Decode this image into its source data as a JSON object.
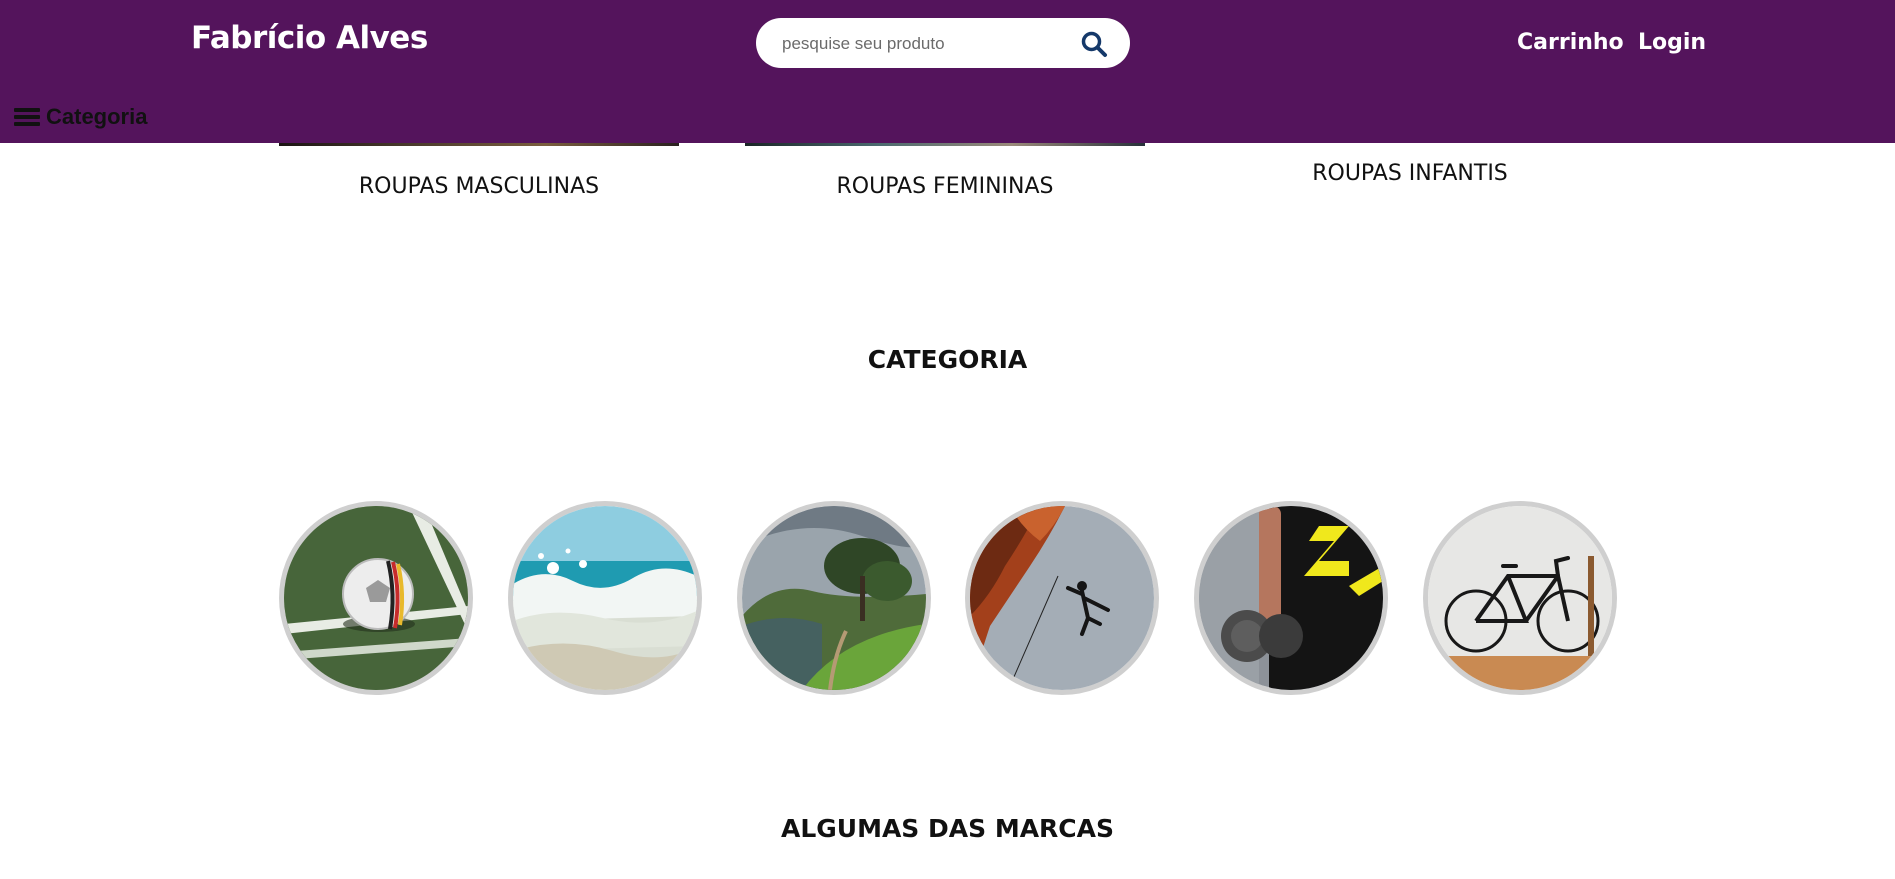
{
  "header": {
    "brand": "Fabrício Alves",
    "search": {
      "placeholder": "pesquise seu produto",
      "value": ""
    },
    "nav": {
      "cart": "Carrinho",
      "login": "Login"
    },
    "category_toggle": "Categoria"
  },
  "colors": {
    "header_bg": "#54145c",
    "circle_border": "#cfcfcf"
  },
  "clothing_categories": [
    {
      "label": "ROUPAS MASCULINAS"
    },
    {
      "label": "ROUPAS FEMININAS"
    },
    {
      "label": "ROUPAS INFANTIS"
    }
  ],
  "sections": {
    "category_title": "CATEGORIA",
    "brands_title": "ALGUMAS DAS MARCAS"
  },
  "sport_categories": [
    {
      "icon": "soccer-ball-image"
    },
    {
      "icon": "ocean-wave-image"
    },
    {
      "icon": "trail-landscape-image"
    },
    {
      "icon": "rock-climbing-image"
    },
    {
      "icon": "dumbbell-fitness-image"
    },
    {
      "icon": "bicycle-image"
    }
  ]
}
